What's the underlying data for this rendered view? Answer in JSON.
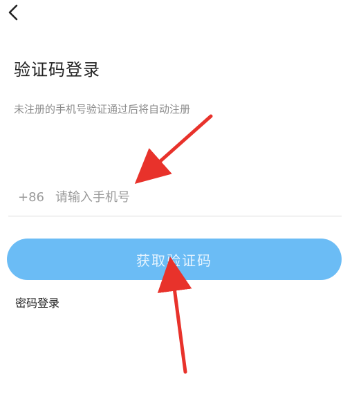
{
  "header": {
    "back_icon": "chevron-left-icon"
  },
  "main": {
    "title": "验证码登录",
    "subtitle": "未注册的手机号验证通过后将自动注册",
    "phone": {
      "country_code": "+86",
      "placeholder": "请输入手机号",
      "value": ""
    },
    "get_code_label": "获取验证码",
    "password_login_label": "密码登录"
  },
  "annotations": {
    "arrow_color": "#e8322b",
    "icon": "red-arrow-icon"
  },
  "colors": {
    "primary_button": "#6bbcf5",
    "button_text": "#e4f3fe",
    "hint_text": "#9a9a9a",
    "divider": "#dcdcdc"
  }
}
